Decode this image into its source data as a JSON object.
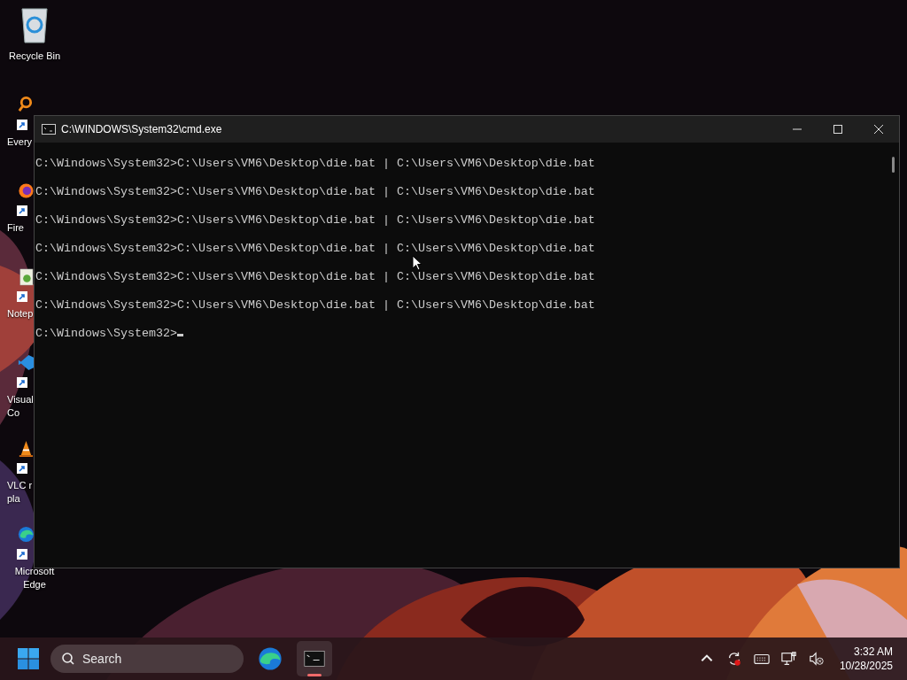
{
  "desktop_icons": [
    {
      "kind": "recycle",
      "shortcut": false,
      "label_lines": [
        "Recycle Bin"
      ]
    },
    {
      "kind": "everything",
      "shortcut": true,
      "label_lines": [
        "Every"
      ]
    },
    {
      "kind": "firefox",
      "shortcut": true,
      "label_lines": [
        "Fire"
      ]
    },
    {
      "kind": "notepad",
      "shortcut": true,
      "label_lines": [
        "Notep"
      ]
    },
    {
      "kind": "vscode",
      "shortcut": true,
      "label_lines": [
        "Visual",
        "Co"
      ]
    },
    {
      "kind": "vlc",
      "shortcut": true,
      "label_lines": [
        "VLC r",
        "pla"
      ]
    },
    {
      "kind": "edge",
      "shortcut": true,
      "label_lines": [
        "Microsoft",
        "Edge"
      ]
    }
  ],
  "window": {
    "title": "C:\\WINDOWS\\System32\\cmd.exe",
    "cursor_visible": true,
    "lines": [
      "C:\\Windows\\System32>C:\\Users\\VM6\\Desktop\\die.bat | C:\\Users\\VM6\\Desktop\\die.bat",
      "C:\\Windows\\System32>C:\\Users\\VM6\\Desktop\\die.bat | C:\\Users\\VM6\\Desktop\\die.bat",
      "C:\\Windows\\System32>C:\\Users\\VM6\\Desktop\\die.bat | C:\\Users\\VM6\\Desktop\\die.bat",
      "C:\\Windows\\System32>C:\\Users\\VM6\\Desktop\\die.bat | C:\\Users\\VM6\\Desktop\\die.bat",
      "C:\\Windows\\System32>C:\\Users\\VM6\\Desktop\\die.bat | C:\\Users\\VM6\\Desktop\\die.bat",
      "C:\\Windows\\System32>C:\\Users\\VM6\\Desktop\\die.bat | C:\\Users\\VM6\\Desktop\\die.bat",
      "C:\\Windows\\System32>"
    ]
  },
  "taskbar": {
    "search": {
      "placeholder": "Search"
    },
    "apps": [
      {
        "kind": "edge",
        "running": false
      },
      {
        "kind": "terminal",
        "running": true
      }
    ],
    "clock": {
      "time": "3:32 AM",
      "date": "10/28/2025"
    }
  }
}
